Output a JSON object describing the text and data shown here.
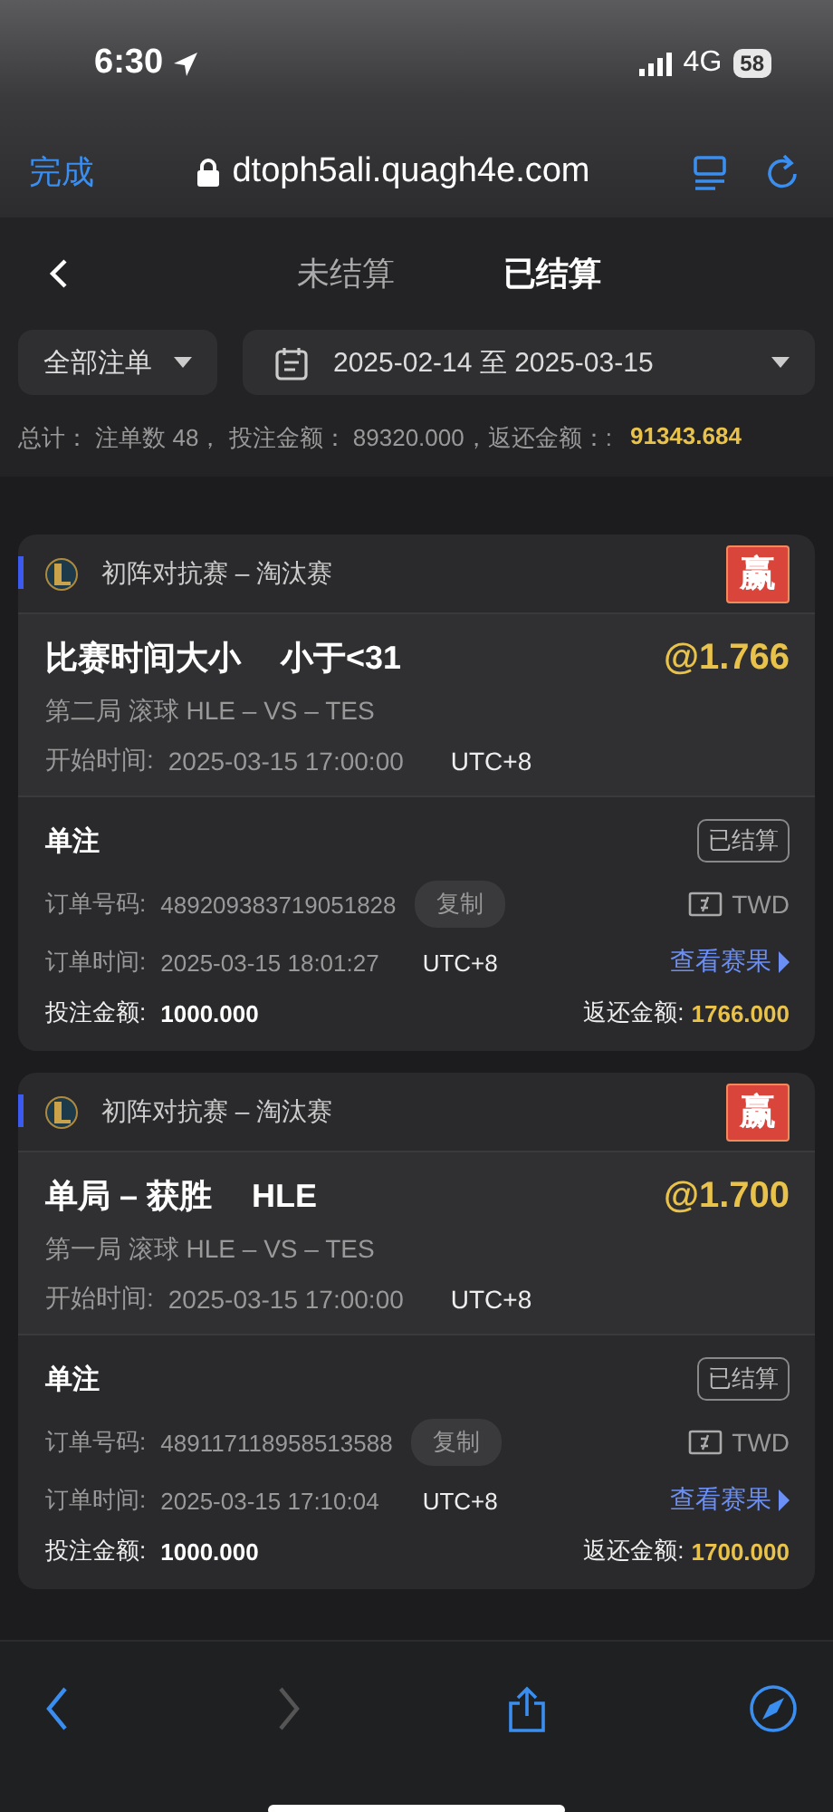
{
  "status_bar": {
    "time": "6:30",
    "network": "4G",
    "battery": "58"
  },
  "browser": {
    "done": "完成",
    "url": "dtoph5ali.quagh4e.com"
  },
  "tabs": [
    {
      "label": "未结算",
      "selected": false
    },
    {
      "label": "已结算",
      "selected": true
    }
  ],
  "filters": {
    "type": "全部注单",
    "date_range": "2025-02-14 至 2025-03-15"
  },
  "summary": {
    "text": "总计：  注单数 48，  投注金额：  89320.000，返还金额：:",
    "total_return": "91343.684"
  },
  "bets": [
    {
      "league": "初阵对抗赛 – 淘汰赛",
      "result": "赢",
      "market": "比赛时间大小",
      "selection": "小于<31",
      "odds": "@1.766",
      "match": "第二局 滚球  HLE – VS – TES",
      "start_label": "开始时间:",
      "start_time": "2025-03-15 17:00:00",
      "start_tz": "UTC+8",
      "bet_type": "单注",
      "status": "已结算",
      "order_label": "订单号码:",
      "order_no": "489209383719051828",
      "copy": "复制",
      "currency": "TWD",
      "time_label": "订单时间:",
      "order_time": "2025-03-15 18:01:27",
      "order_tz": "UTC+8",
      "link": "查看赛果",
      "stake_label": "投注金额:",
      "stake": "1000.000",
      "return_label": "返还金额:",
      "return": "1766.000"
    },
    {
      "league": "初阵对抗赛 – 淘汰赛",
      "result": "赢",
      "market": "单局 – 获胜",
      "selection": "HLE",
      "odds": "@1.700",
      "match": "第一局 滚球  HLE – VS – TES",
      "start_label": "开始时间:",
      "start_time": "2025-03-15 17:00:00",
      "start_tz": "UTC+8",
      "bet_type": "单注",
      "status": "已结算",
      "order_label": "订单号码:",
      "order_no": "489117118958513588",
      "copy": "复制",
      "currency": "TWD",
      "time_label": "订单时间:",
      "order_time": "2025-03-15 17:10:04",
      "order_tz": "UTC+8",
      "link": "查看赛果",
      "stake_label": "投注金额:",
      "stake": "1000.000",
      "return_label": "返还金额:",
      "return": "1700.000"
    }
  ],
  "toolbar": [
    {
      "kind": "back",
      "disabled": false
    },
    {
      "kind": "forward",
      "disabled": true
    },
    {
      "kind": "share",
      "disabled": false
    },
    {
      "kind": "compass",
      "disabled": false
    }
  ]
}
